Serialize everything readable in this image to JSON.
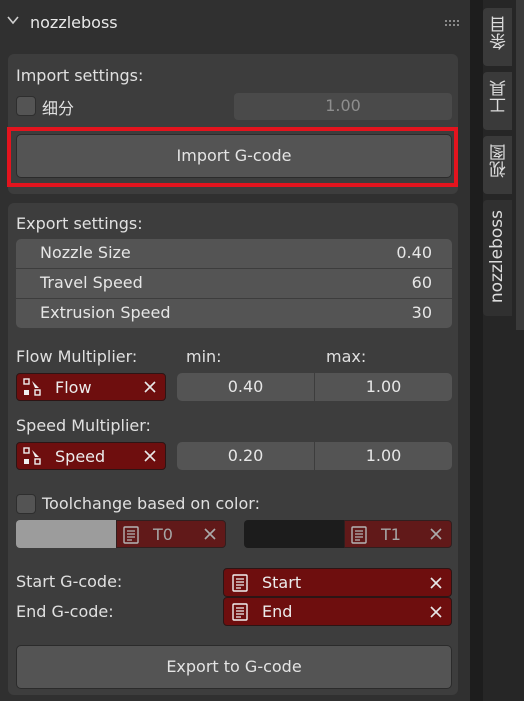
{
  "panel": {
    "title": "nozzleboss"
  },
  "import": {
    "heading": "Import settings:",
    "subdivide_label": "细分",
    "subdivide_value": "1.00",
    "import_button": "Import G-code"
  },
  "export": {
    "heading": "Export settings:",
    "props": [
      {
        "name": "Nozzle Size",
        "value": "0.40"
      },
      {
        "name": "Travel Speed",
        "value": "60"
      },
      {
        "name": "Extrusion Speed",
        "value": "30"
      }
    ],
    "flow": {
      "label": "Flow Multiplier:",
      "min_label": "min:",
      "max_label": "max:",
      "attr": "Flow",
      "min": "0.40",
      "max": "1.00"
    },
    "speed": {
      "label": "Speed Multiplier:",
      "attr": "Speed",
      "min": "0.20",
      "max": "1.00"
    },
    "toolchange": {
      "label": "Toolchange based on color:",
      "t0": "T0",
      "t1": "T1",
      "color0": "#9c9c9c",
      "color1": "#1c1c1c"
    },
    "start": {
      "label": "Start G-code:",
      "text": "Start"
    },
    "end": {
      "label": "End G-code:",
      "text": "End"
    },
    "export_button": "Export to G-code"
  },
  "tabs": [
    "条目",
    "工具",
    "视图",
    "nozzleboss"
  ],
  "colors": {
    "highlight": "#e3141e",
    "field_red": "#6e0e0e"
  }
}
